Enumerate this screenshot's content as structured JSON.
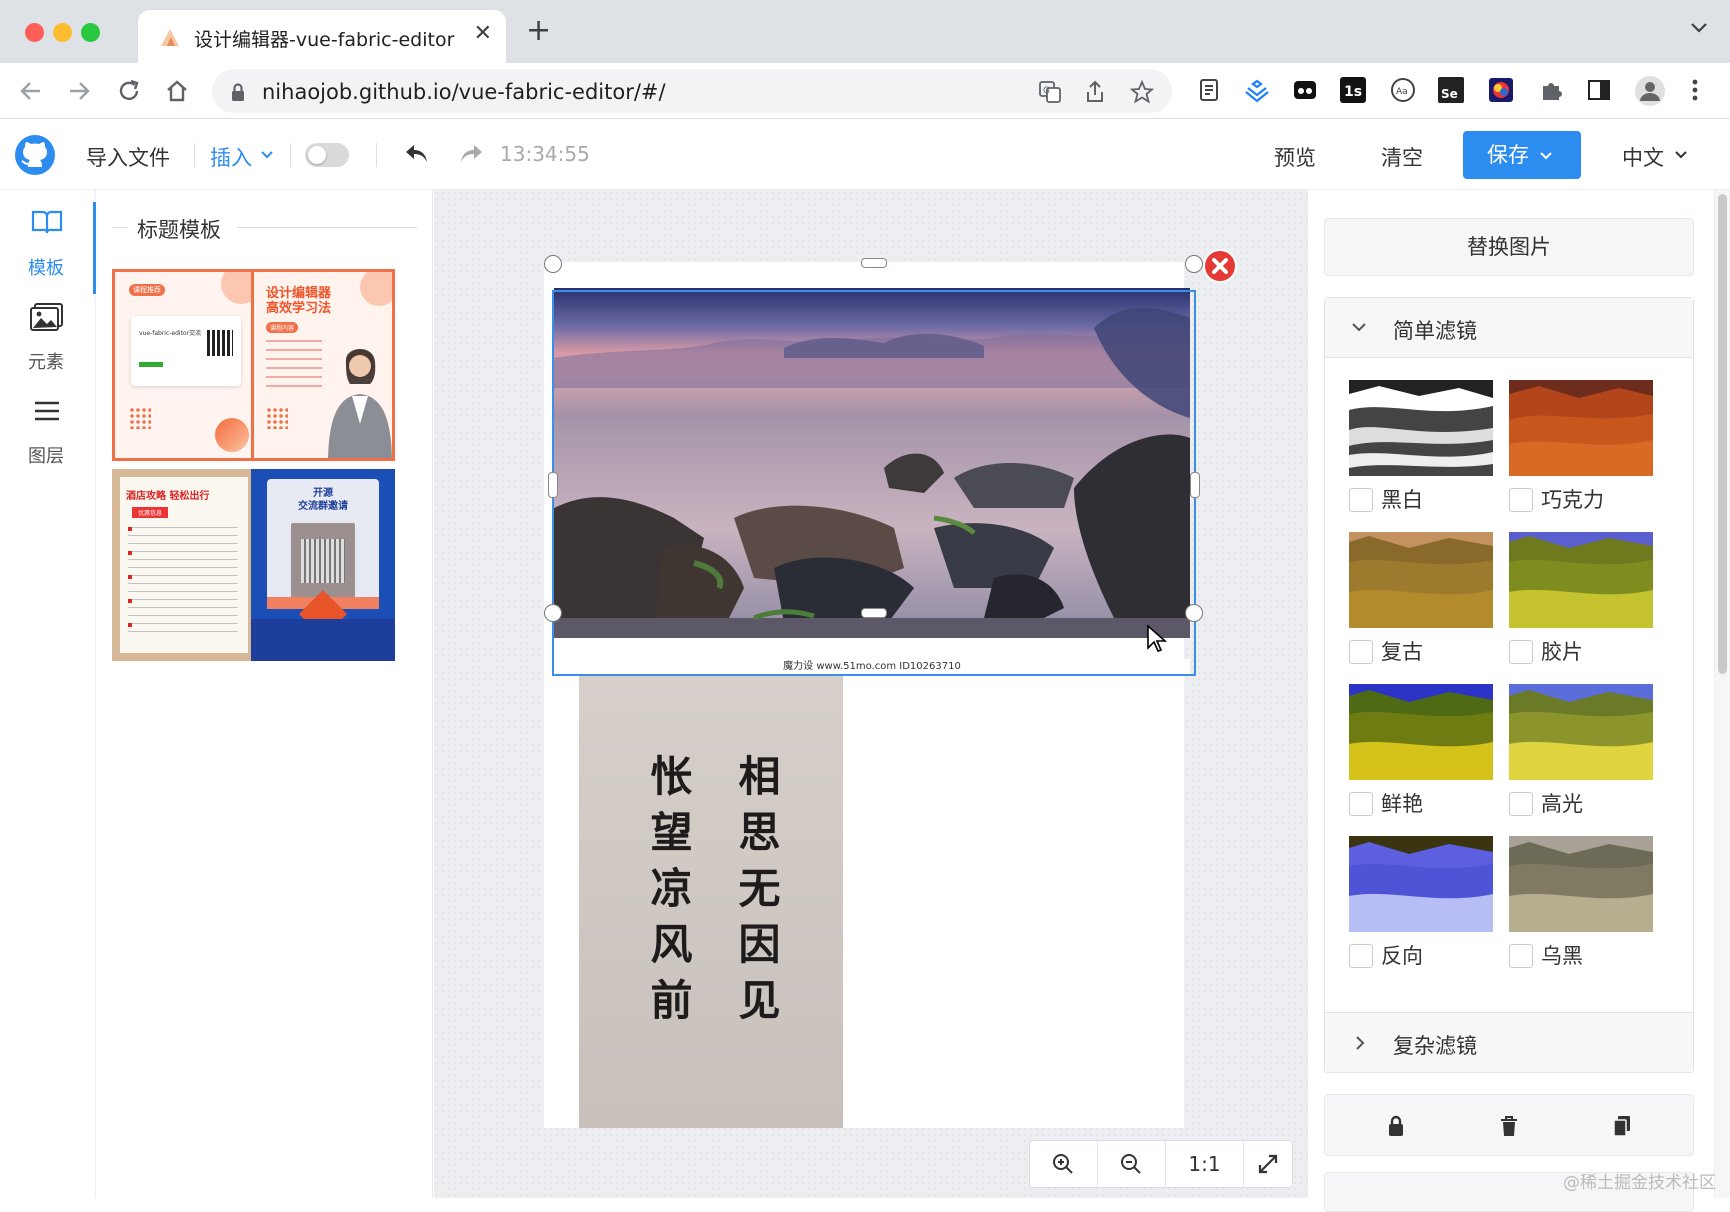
{
  "browser": {
    "tab_title": "设计编辑器-vue-fabric-editor",
    "url": "nihaojob.github.io/vue-fabric-editor/#/"
  },
  "toolbar": {
    "import_label": "导入文件",
    "insert_label": "插入",
    "time": "13:34:55",
    "preview_label": "预览",
    "clear_label": "清空",
    "save_label": "保存",
    "language_label": "中文"
  },
  "sidebar": {
    "items": [
      {
        "label": "模板",
        "icon": "book-icon",
        "active": true
      },
      {
        "label": "元素",
        "icon": "image-icon",
        "active": false
      },
      {
        "label": "图层",
        "icon": "layers-icon",
        "active": false
      }
    ]
  },
  "templates": {
    "title": "标题模板",
    "items": [
      {
        "name": "vue-fabric-editor交流",
        "tag": "课程推荐",
        "heading": ""
      },
      {
        "name": "设计编辑器 高效学习法",
        "tag": "课程内容",
        "heading": "设计编辑器\n高效学习法"
      },
      {
        "name": "酒店攻略 轻松出行",
        "tag": "优惠信息",
        "heading": "酒店攻略 轻松出行"
      },
      {
        "name": "开源交流群邀请",
        "tag": "",
        "heading": "开源\n交流群邀请"
      }
    ]
  },
  "canvas": {
    "photo_caption": "魔力设 www.51mo.com ID10263710",
    "calligraphy": {
      "right_column": "相思无因见",
      "left_column": "怅望凉风前"
    },
    "zoom": {
      "reset_label": "1:1"
    }
  },
  "right_panel": {
    "replace_label": "替换图片",
    "simple_filters_title": "简单滤镜",
    "filters": [
      {
        "label": "黑白",
        "checked": false
      },
      {
        "label": "巧克力",
        "checked": false
      },
      {
        "label": "复古",
        "checked": false
      },
      {
        "label": "胶片",
        "checked": false
      },
      {
        "label": "鲜艳",
        "checked": false
      },
      {
        "label": "高光",
        "checked": false
      },
      {
        "label": "反向",
        "checked": false
      },
      {
        "label": "乌黑",
        "checked": false
      }
    ],
    "complex_filters_title": "复杂滤镜"
  },
  "watermark": "@稀土掘金技术社区",
  "colors": {
    "accent": "#2d8cf0",
    "selection": "#3b8fe8",
    "delete": "#e53935"
  }
}
